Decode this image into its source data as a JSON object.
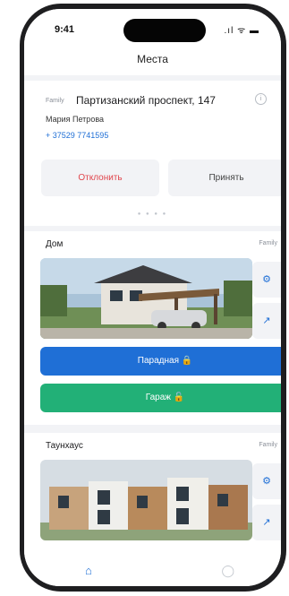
{
  "status_bar": {
    "time": "9:41",
    "icons": ".ıl ᯤ ▬"
  },
  "header": {
    "title": "Места"
  },
  "request": {
    "tag": "Family",
    "address": "Партизанский проспект, 147",
    "name": "Мария Петрова",
    "phone": "+ 37529 7741595",
    "decline_label": "Отклонить",
    "accept_label": "Принять",
    "pager": "● ● ● ●"
  },
  "places": [
    {
      "title": "Дом",
      "tag": "Family",
      "gear_icon": "⚙",
      "share_icon": "↗",
      "door_label": "Парадная 🔒",
      "garage_label": "Гараж 🔓"
    },
    {
      "title": "Таунхаус",
      "tag": "Family",
      "gear_icon": "⚙",
      "share_icon": "↗"
    }
  ],
  "tabbar": {
    "home_icon": "⌂",
    "profile_icon": "◯"
  },
  "colors": {
    "accent": "#1f6fd6",
    "success": "#22b077",
    "danger": "#e0454c"
  }
}
